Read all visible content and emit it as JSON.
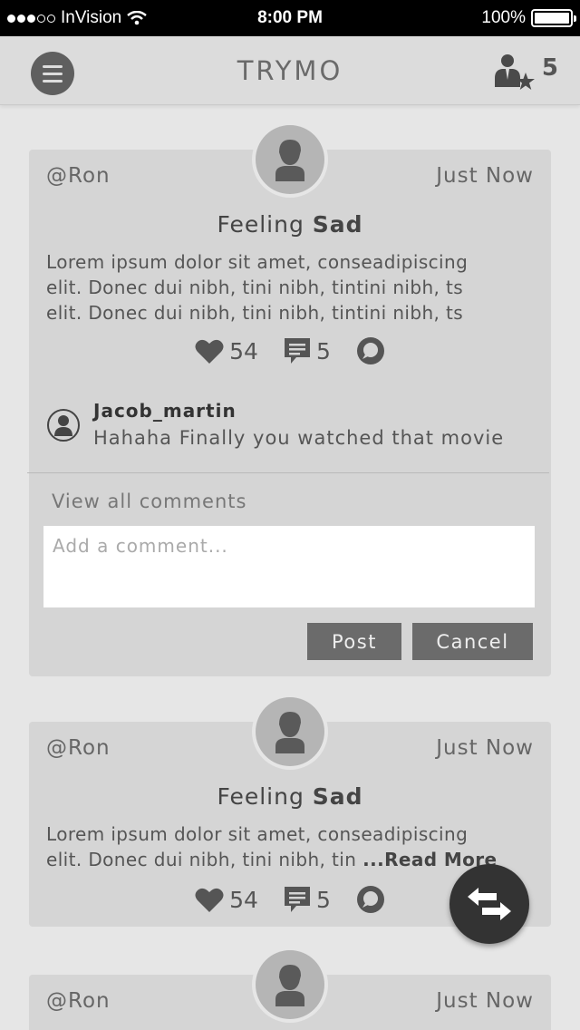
{
  "status_bar": {
    "carrier": "InVision",
    "time": "8:00 PM",
    "battery": "100%"
  },
  "nav": {
    "title": "TRYMO",
    "friends_count": "5",
    "icons": [
      "menu-icon",
      "friends-star-icon"
    ]
  },
  "posts": [
    {
      "username": "@Ron",
      "timestamp": "Just Now",
      "feeling_prefix": "Feeling ",
      "feeling": "Sad",
      "lines": [
        "Lorem ipsum dolor sit amet, conseadipiscing",
        "elit. Donec dui nibh, tini nibh, tintini nibh, ts",
        "elit. Donec dui nibh, tini nibh, tintini nibh, ts"
      ],
      "likes": "54",
      "comments": "5",
      "comment": {
        "author": "Jacob_martin",
        "text": "Hahaha Finally you watched that movie"
      },
      "view_all": "View all comments",
      "input_placeholder": "Add a comment...",
      "post_label": "Post",
      "cancel_label": "Cancel"
    },
    {
      "username": "@Ron",
      "timestamp": "Just Now",
      "feeling_prefix": "Feeling ",
      "feeling": "Sad",
      "lines": [
        "Lorem ipsum dolor sit amet, conseadipiscing",
        "elit. Donec dui nibh, tini nibh, tin "
      ],
      "read_more": "...Read More",
      "likes": "54",
      "comments": "5"
    },
    {
      "username": "@Ron",
      "timestamp": "Just Now"
    }
  ],
  "colors": {
    "background": "#e6e6e6",
    "card": "#d5d5d5",
    "button": "#6b6b6b",
    "fab": "#333333"
  }
}
